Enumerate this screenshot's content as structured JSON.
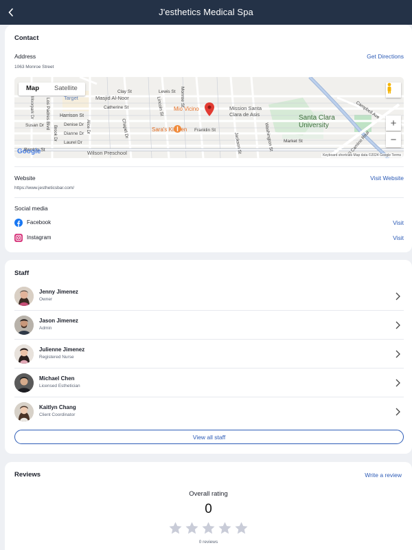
{
  "header": {
    "title": "J'esthetics Medical Spa"
  },
  "contact": {
    "title": "Contact",
    "address_label": "Address",
    "address": "1063 Monroe Street",
    "get_directions": "Get Directions",
    "website_label": "Website",
    "website": "https://www.jestheticsbar.com/",
    "visit_website": "Visit Website",
    "social_label": "Social media",
    "social": [
      {
        "name": "Facebook",
        "action": "Visit",
        "icon": "facebook-icon"
      },
      {
        "name": "Instagram",
        "action": "Visit",
        "icon": "instagram-icon"
      }
    ]
  },
  "map": {
    "type_map": "Map",
    "type_satellite": "Satellite",
    "zoom_in": "+",
    "zoom_out": "−",
    "logo": "Google",
    "attribution": "Keyboard shortcuts   Map data ©2024 Google   Terms",
    "labels": {
      "mio_vicino": "Mio Vicino",
      "saras_kitchen": "Sara's Kitchen",
      "mission": "Mission Santa\nClara de Asis",
      "scu": "Santa Clara\nUniversity",
      "masjid": "Masjid Al-Noor",
      "target": "Target",
      "wilson": "Wilson Preschool",
      "harrison": "Harrison St",
      "clay": "Clay St",
      "lewis": "Lewis St",
      "catherine": "Catherine St",
      "franklin": "Franklin St",
      "market": "Market St",
      "benton": "Benton St",
      "susan": "Susan Dr",
      "denise": "Denise Dr",
      "dianne": "Dianne Dr",
      "laurel": "Laurel Dr",
      "monroe": "Monroe St",
      "lincoln": "Lincoln St",
      "jackson": "Jackson St",
      "washington": "Washington St",
      "chapel": "Chapel Dr",
      "campbell": "Campbell Ave",
      "el_camino": "El Camino Real",
      "los_padres": "Los Padres Blvd",
      "alice": "Alice Dr",
      "brook": "Brook Dr",
      "moorpark": "Moorpark Dr"
    }
  },
  "staff": {
    "title": "Staff",
    "members": [
      {
        "name": "Jenny Jimenez",
        "role": "Owner"
      },
      {
        "name": "Jason Jimenez",
        "role": "Admin"
      },
      {
        "name": "Julienne Jimenez",
        "role": "Registered Nurse"
      },
      {
        "name": "Michael Chen",
        "role": "Licensed Esthetician"
      },
      {
        "name": "Kaitlyn Chang",
        "role": "Client Coordinator"
      }
    ],
    "view_all": "View all staff"
  },
  "reviews": {
    "title": "Reviews",
    "write": "Write a review",
    "overall_label": "Overall rating",
    "rating": "0",
    "stars_filled": 0,
    "stars_total": 5,
    "count_text": "0 reviews"
  },
  "colors": {
    "header_bg": "#243247",
    "link": "#2c5bb6",
    "star_empty": "#c9ccd8"
  }
}
